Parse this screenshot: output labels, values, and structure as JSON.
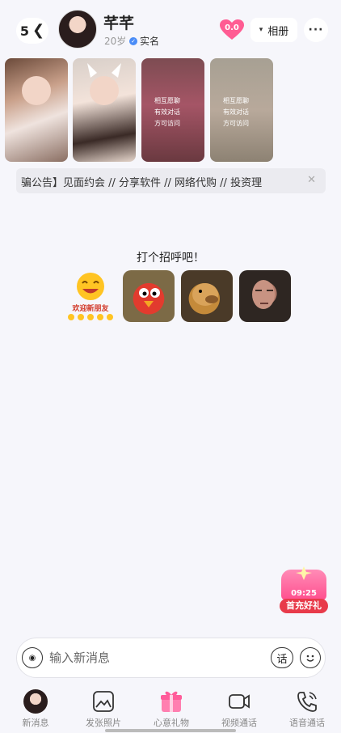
{
  "header": {
    "unread_count": "5",
    "name": "芊芊",
    "age": "20岁",
    "verified_label": "实名",
    "intimacy_value": "0.0",
    "album_label": "相册"
  },
  "photos": {
    "locked_text_line1": "相互愿聊",
    "locked_text_line2": "有效对话",
    "locked_text_line3": "方可访问"
  },
  "notice": {
    "text": "骗公告】见面约会 // 分享软件 // 网络代购 // 投资理"
  },
  "greeting": {
    "title": "打个招呼吧！",
    "sticker1_caption": "欢迎新朋友"
  },
  "promo": {
    "countdown": "09:25",
    "label": "首充好礼"
  },
  "composer": {
    "placeholder": "输入新消息",
    "phrase_label": "话"
  },
  "bottom_nav": {
    "items": [
      {
        "label": "新消息"
      },
      {
        "label": "发张照片"
      },
      {
        "label": "心意礼物"
      },
      {
        "label": "视频通话"
      },
      {
        "label": "语音通话"
      }
    ]
  },
  "colors": {
    "accent_pink": "#ff4f8e",
    "background": "#f6f6fb",
    "verified_blue": "#4a8cf7"
  }
}
